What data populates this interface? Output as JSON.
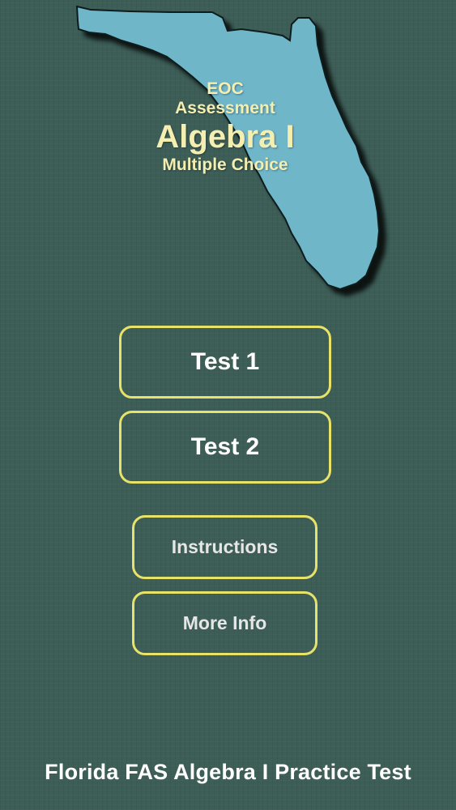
{
  "map": {
    "state_fill": "#70b6c9",
    "state_outline": "#0f1f1c"
  },
  "title": {
    "line1": "EOC",
    "line2": "Assessment",
    "line3": "Algebra I",
    "line4": "Multiple Choice",
    "color": "#f4efb0"
  },
  "buttons": {
    "test1": "Test 1",
    "test2": "Test 2",
    "instructions": "Instructions",
    "more_info": "More Info",
    "border_color": "#e7e36a"
  },
  "footer": {
    "text": "Florida FAS Algebra I Practice Test"
  },
  "colors": {
    "background": "#3d5e57"
  }
}
